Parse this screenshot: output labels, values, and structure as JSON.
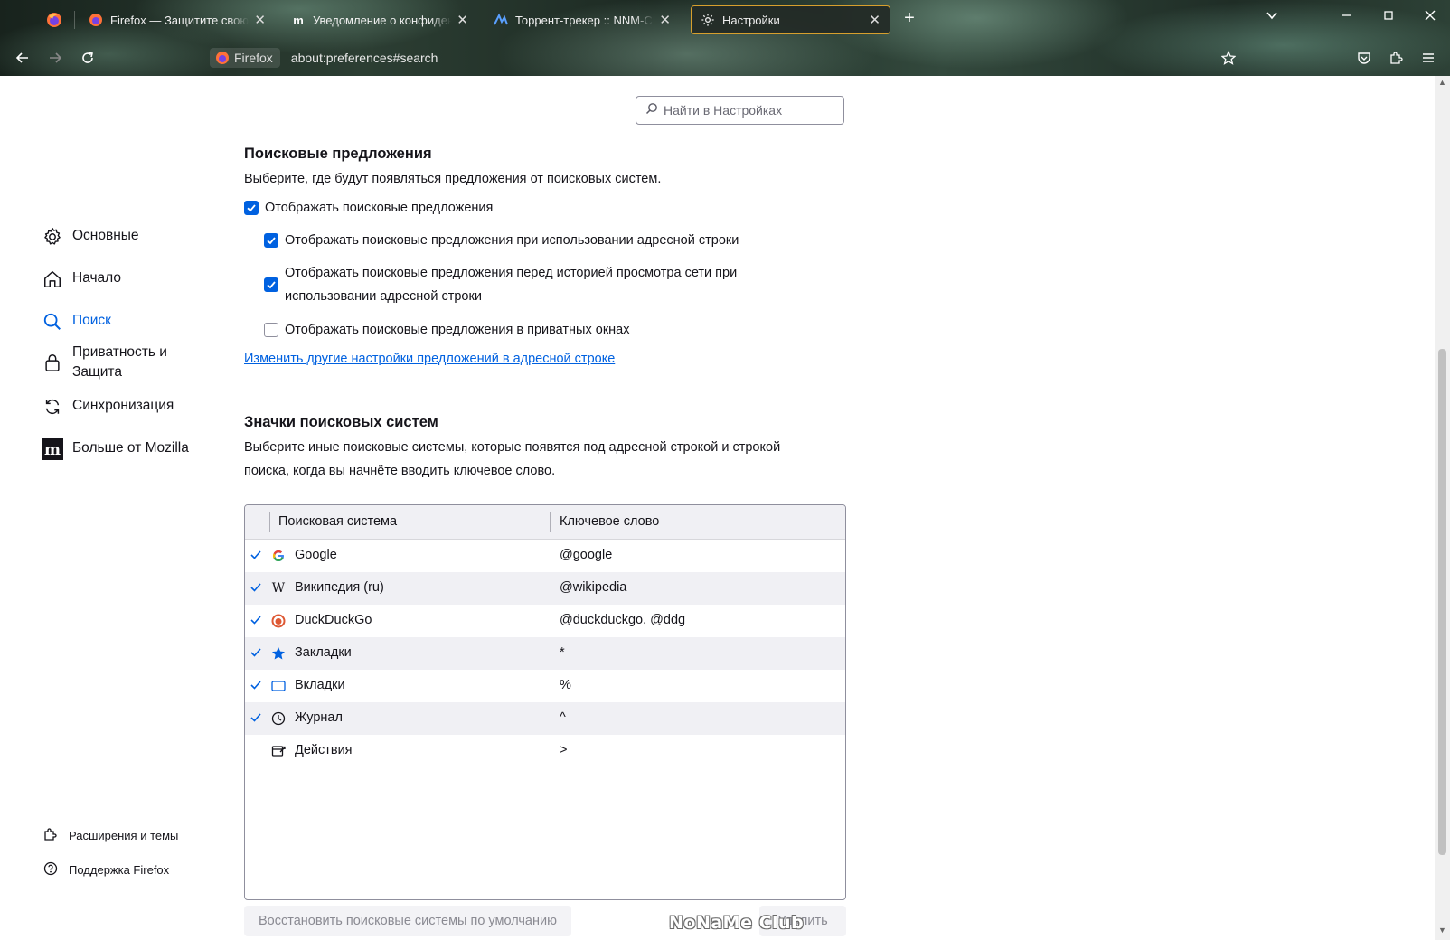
{
  "browser": {
    "tabs": [
      {
        "title": "Firefox — Защитите свою жизнь",
        "icon": "firefox-icon"
      },
      {
        "title": "Уведомление о конфиденциальности",
        "icon": "mozilla-m-icon"
      },
      {
        "title": "Торрент-трекер :: NNM-Club",
        "icon": "nnm-club-icon"
      },
      {
        "title": "Настройки",
        "icon": "gear-icon"
      }
    ],
    "selected_tab": 3,
    "identity_label": "Firefox",
    "url": "about:preferences#search",
    "new_tab_symbol": "+",
    "close_symbol": "✕"
  },
  "search_settings": {
    "placeholder": "Найти в Настройках"
  },
  "sidebar": {
    "categories": [
      {
        "label": "Основные",
        "icon": "gear-icon"
      },
      {
        "label": "Начало",
        "icon": "home-icon"
      },
      {
        "label": "Поиск",
        "icon": "search-icon",
        "selected": true
      },
      {
        "label": "Приватность и Защита",
        "icon": "lock-icon"
      },
      {
        "label": "Синхронизация",
        "icon": "sync-icon"
      },
      {
        "label": "Больше от Mozilla",
        "icon": "mozilla-m-icon"
      }
    ],
    "footer": [
      {
        "label": "Расширения и темы",
        "icon": "puzzle-icon"
      },
      {
        "label": "Поддержка Firefox",
        "icon": "help-icon"
      }
    ]
  },
  "suggestions": {
    "heading": "Поисковые предложения",
    "description": "Выберите, где будут появляться предложения от поисковых систем.",
    "show_suggestions": {
      "label": "Отображать поисковые предложения",
      "checked": true
    },
    "urlbar_suggestions": {
      "label": "Отображать поисковые предложения при использовании адресной строки",
      "checked": true
    },
    "before_history": {
      "label": "Отображать поисковые предложения перед историей просмотра сети при использовании адресной строки",
      "checked": true
    },
    "private_windows": {
      "label": "Отображать поисковые предложения в приватных окнах",
      "checked": false
    },
    "link": "Изменить другие настройки предложений в адресной строке"
  },
  "shortcuts": {
    "heading": "Значки поисковых систем",
    "description": "Выберите иные поисковые системы, которые появятся под адресной строкой и строкой поиска, когда вы начнёте вводить ключевое слово.",
    "columns": {
      "engine": "Поисковая система",
      "keyword": "Ключевое слово"
    },
    "rows": [
      {
        "name": "Google",
        "keyword": "@google",
        "checked": true,
        "icon": "google-icon"
      },
      {
        "name": "Википедия (ru)",
        "keyword": "@wikipedia",
        "checked": true,
        "icon": "wikipedia-icon"
      },
      {
        "name": "DuckDuckGo",
        "keyword": "@duckduckgo, @ddg",
        "checked": true,
        "icon": "duckduckgo-icon"
      },
      {
        "name": "Закладки",
        "keyword": "*",
        "checked": true,
        "icon": "star-icon"
      },
      {
        "name": "Вкладки",
        "keyword": "%",
        "checked": true,
        "icon": "tab-icon"
      },
      {
        "name": "Журнал",
        "keyword": "^",
        "checked": true,
        "icon": "clock-icon"
      },
      {
        "name": "Действия",
        "keyword": ">",
        "checked": false,
        "icon": "actions-icon"
      }
    ],
    "restore_button": "Восстановить поисковые системы по умолчанию",
    "remove_button": "Удалить"
  },
  "watermark": "NoNaMe Club",
  "colors": {
    "accent": "#0061e0",
    "selected_tab_border": "#d79f2d"
  }
}
